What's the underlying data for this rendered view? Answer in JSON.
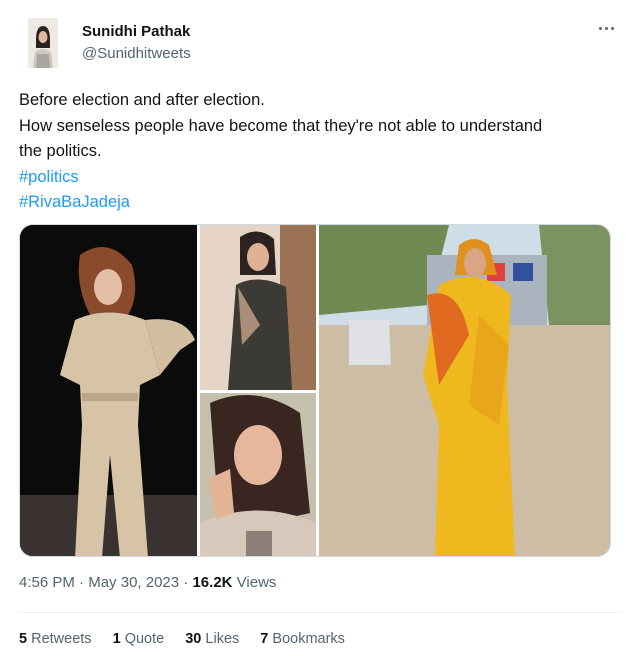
{
  "author": {
    "name": "Sunidhi Pathak",
    "handle": "@Sunidhitweets"
  },
  "tweet": {
    "lines": [
      "Before election and after election.",
      "How senseless people have become that they're not able to understand",
      "the politics."
    ],
    "hashtags": [
      "#politics",
      "#RivaBaJadeja"
    ]
  },
  "media": {
    "count": 4,
    "photos": [
      {
        "name": "woman-beige-jumpsuit-photo"
      },
      {
        "name": "woman-sequin-dress-photo"
      },
      {
        "name": "woman-selfie-photo"
      },
      {
        "name": "woman-yellow-saree-voting-photo"
      }
    ]
  },
  "meta": {
    "time": "4:56 PM",
    "separator": "·",
    "date": "May 30, 2023",
    "views_count": "16.2K",
    "views_label": "Views"
  },
  "stats": {
    "retweets_count": "5",
    "retweets_label": "Retweets",
    "quotes_count": "1",
    "quotes_label": "Quote",
    "likes_count": "30",
    "likes_label": "Likes",
    "bookmarks_count": "7",
    "bookmarks_label": "Bookmarks"
  },
  "colors": {
    "link": "#1d9bf0",
    "secondary_text": "#536471",
    "primary_text": "#0f1419",
    "divider": "#eff3f4"
  },
  "icons": [
    "more-options-icon"
  ]
}
